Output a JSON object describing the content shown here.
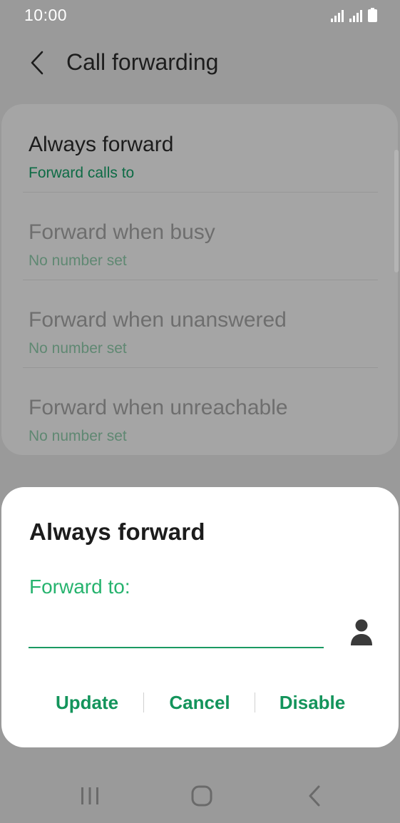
{
  "status_bar": {
    "time": "10:00",
    "icons": [
      "signal-icon",
      "signal-icon",
      "battery-icon"
    ]
  },
  "app_bar": {
    "title": "Call forwarding",
    "back_icon": "chevron-left-icon"
  },
  "settings": {
    "items": [
      {
        "title": "Always forward",
        "subtitle": "Forward calls to",
        "state": "active"
      },
      {
        "title": "Forward when busy",
        "subtitle": "No number set",
        "state": "disabled"
      },
      {
        "title": "Forward when unanswered",
        "subtitle": "No number set",
        "state": "disabled"
      },
      {
        "title": "Forward when unreachable",
        "subtitle": "No number set",
        "state": "disabled"
      }
    ]
  },
  "dialog": {
    "title": "Always forward",
    "field_label": "Forward to:",
    "input_value": "",
    "input_placeholder": "",
    "contact_icon": "person-icon",
    "actions": {
      "update": "Update",
      "cancel": "Cancel",
      "disable": "Disable"
    }
  },
  "nav_bar": {
    "recents_icon": "recents-icon",
    "home_icon": "home-icon",
    "back_icon": "back-icon"
  },
  "colors": {
    "accent": "#13945b",
    "label_green": "#26b36e",
    "scrim": "#9a9a9a",
    "dialog_bg": "#ffffff"
  }
}
